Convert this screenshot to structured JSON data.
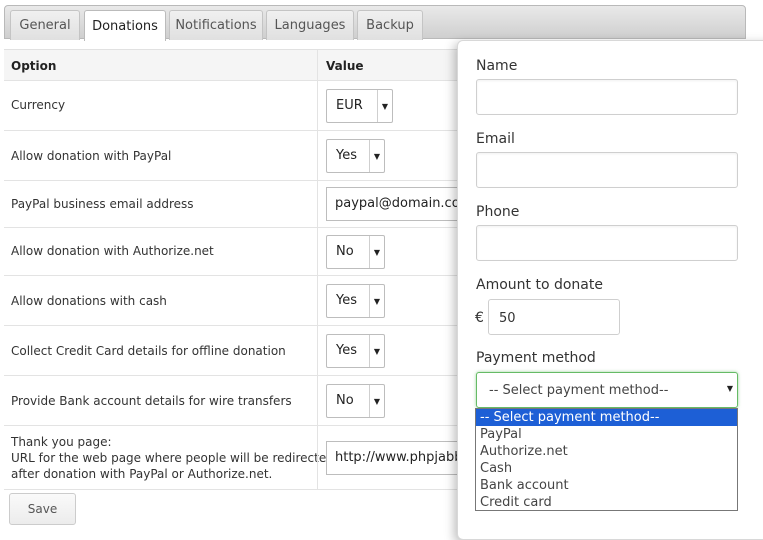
{
  "tabs": [
    {
      "label": "General"
    },
    {
      "label": "Donations"
    },
    {
      "label": "Notifications"
    },
    {
      "label": "Languages"
    },
    {
      "label": "Backup"
    }
  ],
  "active_tab": "Donations",
  "table": {
    "headers": {
      "option": "Option",
      "value": "Value"
    },
    "rows": [
      {
        "label": "Currency",
        "value": "EUR"
      },
      {
        "label": "Allow donation with PayPal",
        "value": "Yes"
      },
      {
        "label": "PayPal business email address",
        "value": "paypal@domain.com"
      },
      {
        "label": "Allow donation with Authorize.net",
        "value": "No"
      },
      {
        "label": "Allow donations with cash",
        "value": "Yes"
      },
      {
        "label": "Collect Credit Card details for offline donation",
        "value": "Yes"
      },
      {
        "label": "Provide Bank account details for wire transfers",
        "value": "No"
      }
    ],
    "thankyou": {
      "label1": "Thank you page:",
      "label2": "URL for the web page where people will be redirected",
      "label3": "after donation with PayPal or Authorize.net.",
      "value": "http://www.phpjabb"
    }
  },
  "save_label": "Save",
  "form": {
    "name_label": "Name",
    "email_label": "Email",
    "phone_label": "Phone",
    "amount_label": "Amount to donate",
    "currency_symbol": "€",
    "amount_value": "50",
    "payment_label": "Payment method",
    "payment_selected": "-- Select payment method--",
    "payment_options": [
      "-- Select payment method--",
      "PayPal",
      "Authorize.net",
      "Cash",
      "Bank account",
      "Credit card"
    ]
  },
  "icons": {
    "dropdown_arrow": "▼"
  },
  "colors": {
    "highlight": "#1d5fd6",
    "focus_border": "#66bb66"
  }
}
